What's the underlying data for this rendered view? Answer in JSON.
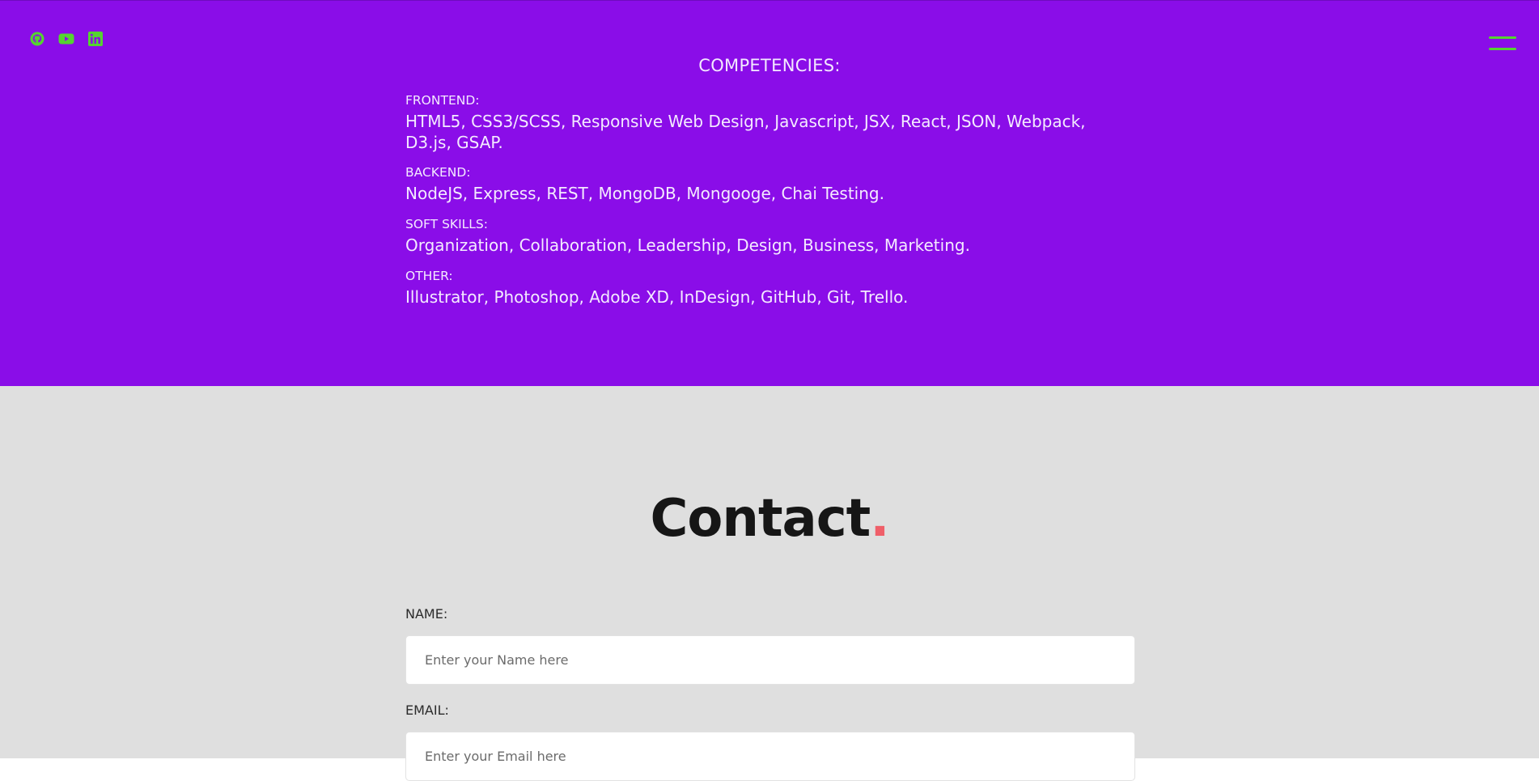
{
  "colors": {
    "purple_bg": "#8a0de8",
    "gray_bg": "#dfdfdf",
    "accent_green": "#55d430",
    "dot_red": "#ef5f69"
  },
  "socials": [
    {
      "icon": "github-icon"
    },
    {
      "icon": "youtube-icon"
    },
    {
      "icon": "linkedin-icon"
    }
  ],
  "competencies": {
    "title": "COMPETENCIES:",
    "groups": [
      {
        "heading": "FRONTEND:",
        "text": "HTML5, CSS3/SCSS, Responsive Web Design, Javascript, JSX, React, JSON, Webpack, D3.js, GSAP."
      },
      {
        "heading": "BACKEND:",
        "text": "NodeJS, Express, REST, MongoDB, Mongooge, Chai Testing."
      },
      {
        "heading": "SOFT SKILLS:",
        "text": "Organization, Collaboration, Leadership, Design, Business, Marketing."
      },
      {
        "heading": "OTHER:",
        "text": "Illustrator, Photoshop, Adobe XD, InDesign, GitHub, Git, Trello."
      }
    ]
  },
  "contact": {
    "title": "Contact",
    "dot": ".",
    "name_label": "NAME:",
    "name_placeholder": "Enter your Name here",
    "email_label": "EMAIL:",
    "email_placeholder": "Enter your Email here"
  }
}
